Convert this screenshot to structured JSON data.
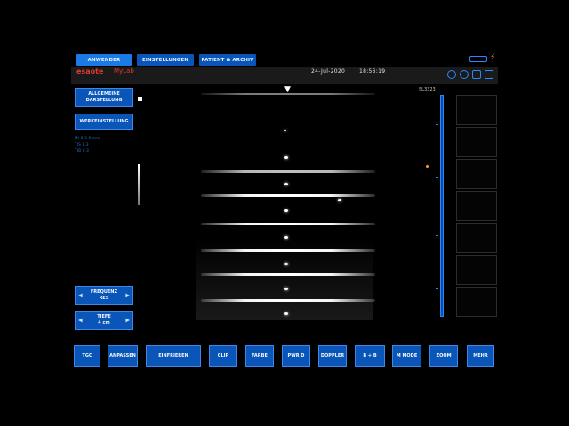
{
  "tabs": [
    "ANWENDER",
    "EINSTELLUNGEN",
    "PATIENT & ARCHIV"
  ],
  "header": {
    "brand": "esaote",
    "product": "MyLab",
    "date": "24-Jul-2020",
    "time": "18:56:19"
  },
  "left_panel": {
    "general_display": [
      "ALLGEMEINE",
      "DARSTELLUNG"
    ],
    "factory_settings": "WERKEINSTELLUNG",
    "meta": [
      "MI  0.3  0 mm",
      "TIS  0.3",
      "TIB  0.3"
    ],
    "frequency": {
      "title": "FREQUENZ",
      "value": "RES"
    },
    "depth": {
      "title": "TIEFE",
      "value": "4 cm"
    }
  },
  "image_info": {
    "label": "SL3323"
  },
  "bottom_toolbar": [
    "TGC",
    "ANPASSEN",
    "EINFRIEREN",
    "CLIP",
    "FARBE",
    "PWR D",
    "DOPPLER",
    "B + B",
    "M MODE",
    "ZOOM",
    "MEHR"
  ],
  "colors": {
    "accent": "#1b7ae6",
    "button": "#0a55b8",
    "brand": "#e03a2f"
  }
}
